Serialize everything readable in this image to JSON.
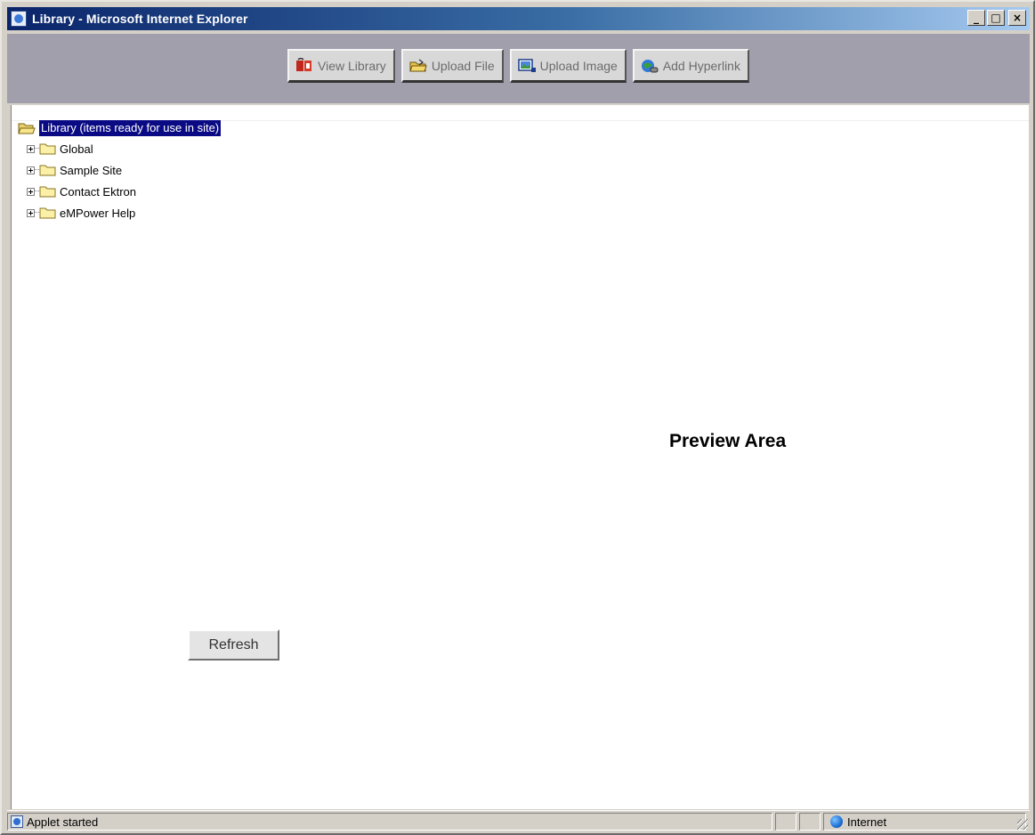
{
  "window": {
    "title": "Library - Microsoft Internet Explorer",
    "controls": [
      "_",
      "□",
      "×"
    ]
  },
  "toolbar": {
    "buttons": [
      {
        "label": "View Library",
        "icon": "view-library-icon"
      },
      {
        "label": "Upload File",
        "icon": "upload-file-icon"
      },
      {
        "label": "Upload Image",
        "icon": "upload-image-icon"
      },
      {
        "label": "Add Hyperlink",
        "icon": "add-hyperlink-icon"
      }
    ]
  },
  "tree": {
    "root": {
      "label": "Library (items ready for use in site)",
      "selected": true
    },
    "items": [
      {
        "label": "Global"
      },
      {
        "label": "Sample Site"
      },
      {
        "label": "Contact Ektron"
      },
      {
        "label": "eMPower Help"
      }
    ]
  },
  "preview": {
    "label": "Preview Area"
  },
  "refresh": {
    "label": "Refresh"
  },
  "status": {
    "text": "Applet started",
    "zone": "Internet"
  },
  "colors": {
    "title_gradient_start": "#0a246a",
    "toolbar_bg": "#a19fac",
    "selection_bg": "#0a0a84"
  }
}
